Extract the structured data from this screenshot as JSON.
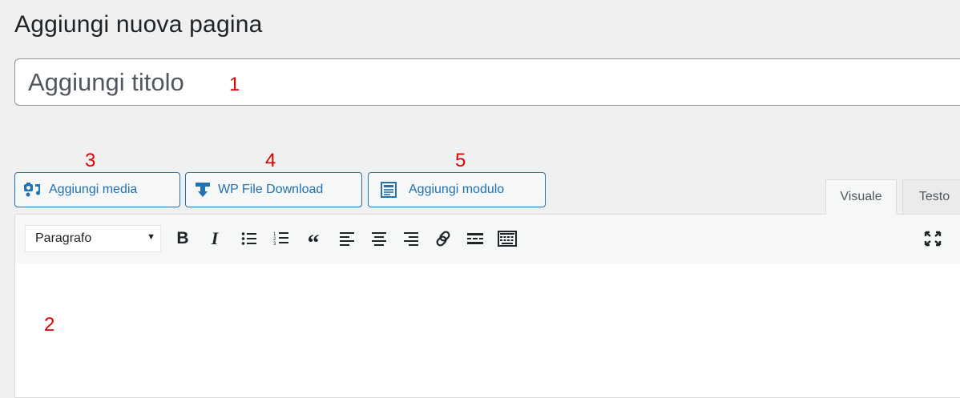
{
  "page": {
    "title": "Aggiungi nuova pagina",
    "title_placeholder": "Aggiungi titolo"
  },
  "annotations": [
    "1",
    "2",
    "3",
    "4",
    "5"
  ],
  "media_buttons": {
    "add_media": "Aggiungi media",
    "wp_file_download": "WP File Download",
    "add_form": "Aggiungi modulo"
  },
  "editor_tabs": {
    "visual": "Visuale",
    "text": "Testo"
  },
  "toolbar": {
    "format_value": "Paragrafo",
    "buttons": [
      "bold-icon",
      "italic-icon",
      "bulleted-list-icon",
      "numbered-list-icon",
      "blockquote-icon",
      "align-left-icon",
      "align-center-icon",
      "align-right-icon",
      "link-icon",
      "read-more-icon",
      "toolbar-toggle-icon",
      "fullscreen-icon"
    ]
  },
  "colors": {
    "accent": "#2271b1",
    "annotation": "#e00000",
    "background": "#f0f0f1"
  }
}
